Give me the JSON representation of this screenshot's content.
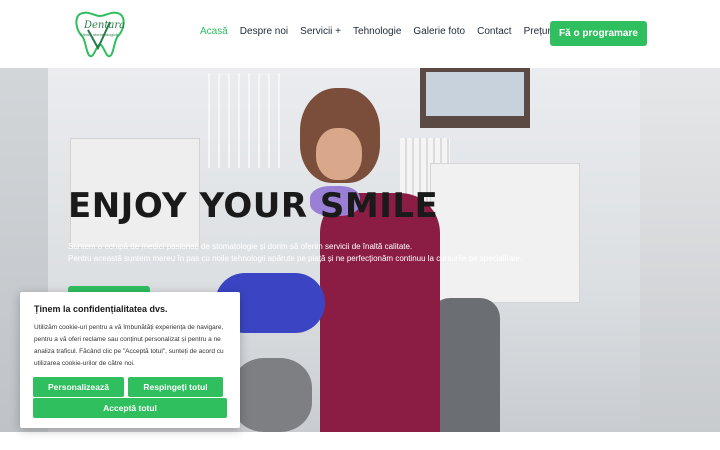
{
  "header": {
    "logo_text": "Dentara",
    "logo_sub": "Clinică stomatologică",
    "nav": [
      {
        "label": "Acasă"
      },
      {
        "label": "Despre noi"
      },
      {
        "label": "Servicii +"
      },
      {
        "label": "Tehnologie"
      },
      {
        "label": "Galerie foto"
      },
      {
        "label": "Contact"
      },
      {
        "label": "Prețuri"
      }
    ],
    "cta_label": "Fă o programare"
  },
  "hero": {
    "title": "ENJOY YOUR SMILE",
    "line1": "Suntem o echipă de medici pasionați de stomatologie și dorim să oferim servicii de înaltă calitate.",
    "line2": "Pentru această suntem mereu în pas cu noile tehnologii apărute pe piață și ne perfecționăm continuu la cursurile de specialitate."
  },
  "cookie": {
    "title": "Ținem la confidențialitatea dvs.",
    "body": "Utilizăm cookie-uri pentru a vă îmbunătăți experiența de navigare, pentru a vă oferi reclame sau conținut personalizat și pentru a ne analiza traficul. Făcând clic pe \"Acceptă totul\", sunteți de acord cu utilizarea cookie-urilor de către noi.",
    "customize_label": "Personalizează",
    "reject_label": "Respingeți totul",
    "accept_label": "Acceptă totul"
  },
  "colors": {
    "accent": "#2fbf5f",
    "nav_text": "#1d2a3a"
  }
}
